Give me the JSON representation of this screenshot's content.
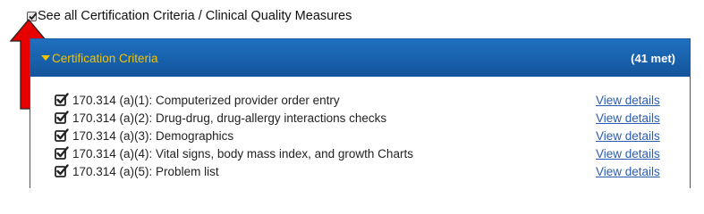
{
  "toggle": {
    "label": "See all Certification Criteria / Clinical Quality Measures",
    "checked": true
  },
  "annotation": {
    "arrow_color": "#e60000",
    "icon": "red-up-arrow"
  },
  "panel": {
    "title": "Certification Criteria",
    "count": "(41 met)",
    "header_color": "#1a63b0",
    "title_color": "#f4c300",
    "items": [
      {
        "label": "170.314 (a)(1): Computerized provider order entry",
        "link": "View details",
        "met": true
      },
      {
        "label": "170.314 (a)(2): Drug-drug, drug-allergy interactions checks",
        "link": "View details",
        "met": true
      },
      {
        "label": "170.314 (a)(3): Demographics",
        "link": "View details",
        "met": true
      },
      {
        "label": "170.314 (a)(4): Vital signs, body mass index, and growth Charts",
        "link": "View details",
        "met": true
      },
      {
        "label": "170.314 (a)(5): Problem list",
        "link": "View details",
        "met": true
      }
    ]
  }
}
